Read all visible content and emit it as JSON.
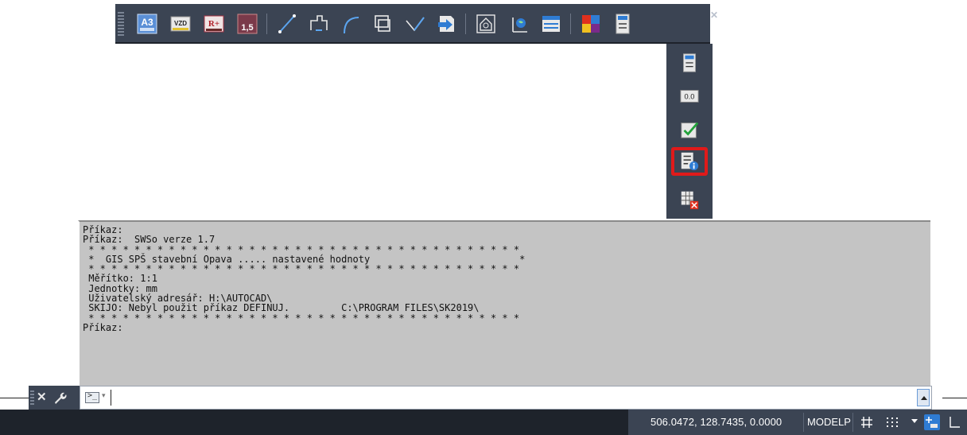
{
  "toolbar": {
    "buttons": [
      {
        "name": "a3-format",
        "text": "A3"
      },
      {
        "name": "vzd",
        "text": "VZD"
      },
      {
        "name": "r-plus",
        "text": "R+"
      },
      {
        "name": "scale-15",
        "text": "1,5"
      },
      {
        "name": "line-tool",
        "text": ""
      },
      {
        "name": "polyline-tool",
        "text": ""
      },
      {
        "name": "arc-tool",
        "text": ""
      },
      {
        "name": "offset-tool",
        "text": ""
      },
      {
        "name": "angle-tool",
        "text": ""
      },
      {
        "name": "insert-tool",
        "text": ""
      },
      {
        "name": "house-tool",
        "text": ""
      },
      {
        "name": "globe-tool",
        "text": ""
      },
      {
        "name": "window-tool",
        "text": ""
      },
      {
        "name": "color-tool",
        "text": ""
      },
      {
        "name": "settings-tool",
        "text": ""
      }
    ]
  },
  "flyout": {
    "zero_label": "0.0"
  },
  "history": {
    "lines": [
      "Příkaz:",
      "Příkaz:  SWSo verze 1.7",
      " * * * * * * * * * * * * * * * * * * * * * * * * * * * * * * * * * * * * * *",
      " *  GIS SPŠ stavební Opava ..... nastavené hodnoty                          *",
      " * * * * * * * * * * * * * * * * * * * * * * * * * * * * * * * * * * * * * *",
      " Měřítko: 1:1",
      " Jednotky: mm",
      " Uživatelský adresář: H:\\AUTOCAD\\",
      " SKIJO: Nebyl použit příkaz DEFINUJ.         C:\\PROGRAM FILES\\SK2019\\",
      " * * * * * * * * * * * * * * * * * * * * * * * * * * * * * * * * * * * * * *",
      "Příkaz:"
    ]
  },
  "command": {
    "close_label": "✕",
    "prompt_label": ">_",
    "value": "",
    "placeholder": ""
  },
  "status": {
    "coordinates": "506.0472, 128.7435, 0.0000",
    "mode": "MODELP"
  },
  "colors": {
    "toolbar_bg": "#3b4453",
    "history_bg": "#c4c4c4",
    "highlight": "#e01a1a",
    "status_bg": "#3b4453"
  }
}
